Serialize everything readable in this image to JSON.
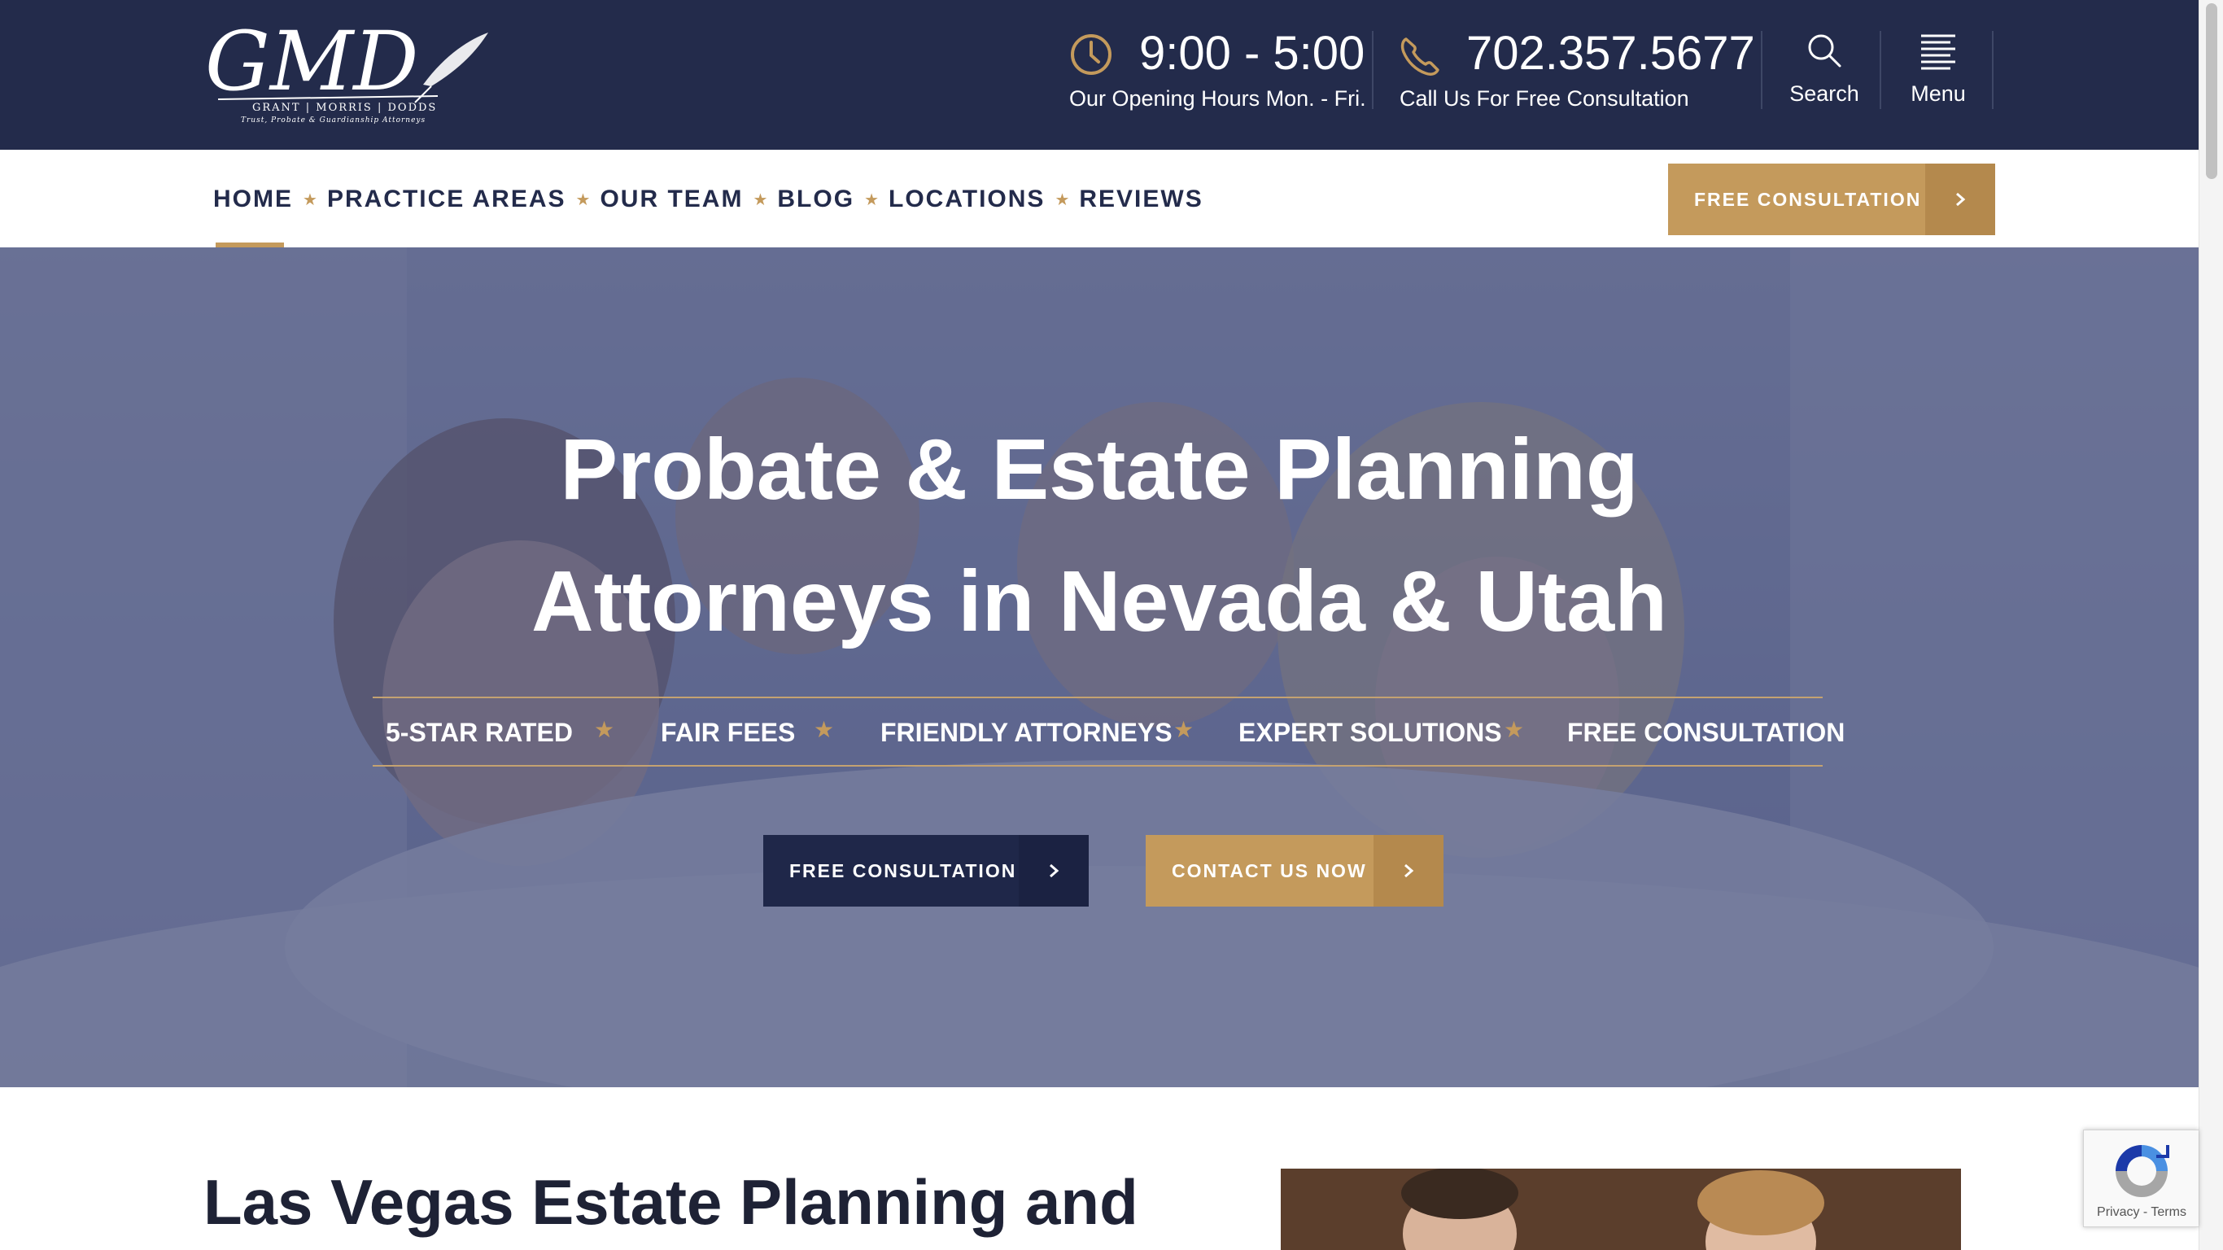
{
  "header": {
    "logo": {
      "monogram": "GMD",
      "firm_names": "GRANT | MORRIS | DODDS",
      "tagline": "Trust, Probate & Guardianship Attorneys"
    },
    "hours": {
      "time": "9:00 - 5:00",
      "caption": "Our Opening Hours Mon. - Fri."
    },
    "phone": {
      "number": "702.357.5677",
      "caption": "Call Us For Free Consultation"
    },
    "search_label": "Search",
    "menu_label": "Menu"
  },
  "nav": {
    "items": [
      "HOME",
      "PRACTICE AREAS",
      "OUR TEAM",
      "BLOG",
      "LOCATIONS",
      "REVIEWS"
    ],
    "separator": "★",
    "cta_label": "FREE CONSULTATION"
  },
  "hero": {
    "title_line1": "Probate & Estate Planning",
    "title_line2": "Attorneys in Nevada & Utah",
    "features": [
      "5-STAR RATED",
      "FAIR FEES",
      "FRIENDLY ATTORNEYS",
      "EXPERT SOLUTIONS",
      "FREE CONSULTATION"
    ],
    "primary_button": "FREE CONSULTATION",
    "secondary_button": "CONTACT US NOW"
  },
  "main": {
    "section_title": "Las Vegas Estate Planning and"
  },
  "recaptcha": {
    "privacy": "Privacy",
    "separator": " - ",
    "terms": "Terms"
  },
  "colors": {
    "navy": "#232b4b",
    "gold": "#c49a5c",
    "gold_dark": "#b4894d",
    "hero_overlay": "#2a3462",
    "text_dark": "#1e2235"
  },
  "icons": [
    "clock-icon",
    "phone-icon",
    "search-icon",
    "menu-icon",
    "chevron-right-icon",
    "star-icon",
    "recaptcha-icon"
  ]
}
